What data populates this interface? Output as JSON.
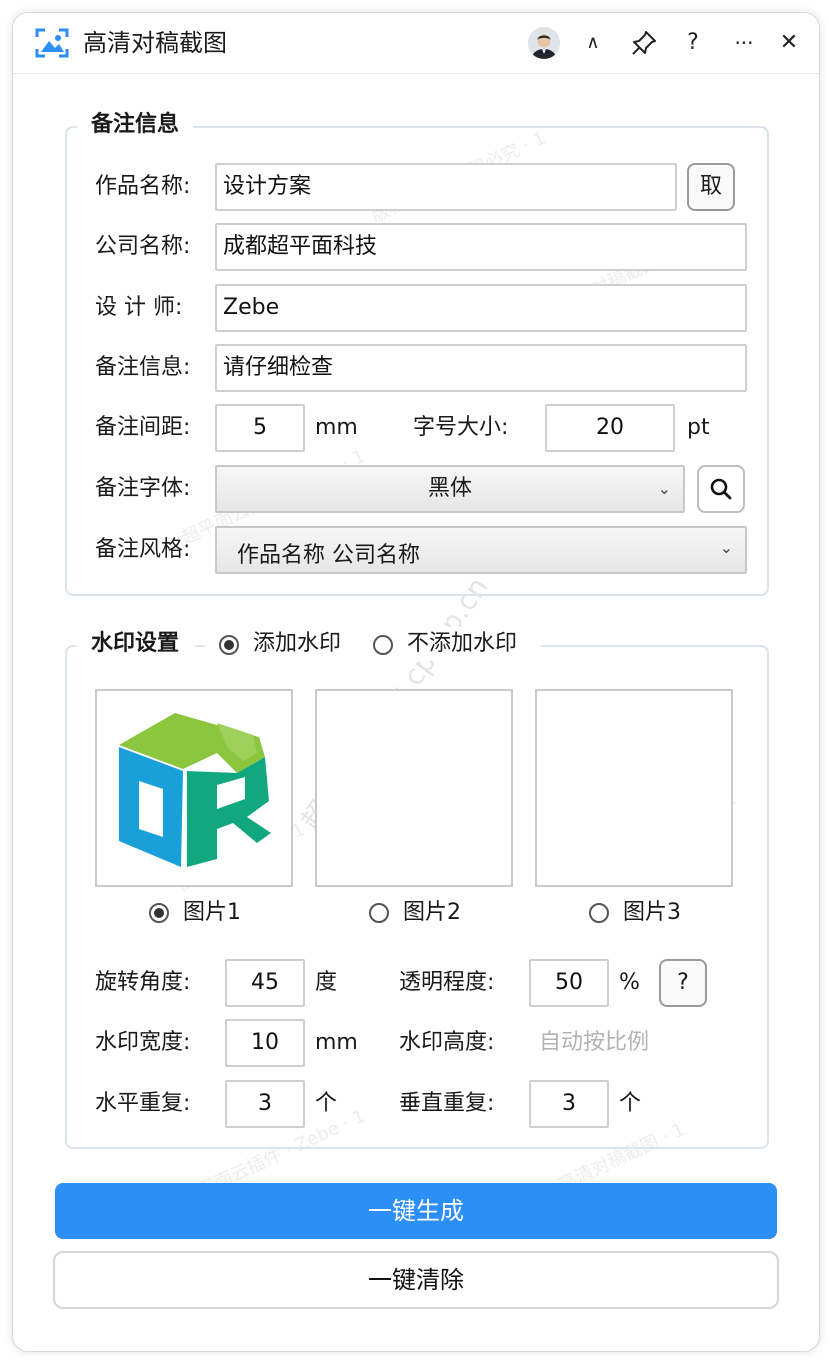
{
  "window": {
    "title": "高清对稿截图",
    "controls": {
      "collapse": "∧",
      "pin": "pin-icon",
      "help": "?",
      "more": "···",
      "close": "✕"
    }
  },
  "notes": {
    "legend": "备注信息",
    "work_name": {
      "label": "作品名称:",
      "value": "设计方案",
      "pick_button": "取"
    },
    "company": {
      "label": "公司名称:",
      "value": "成都超平面科技"
    },
    "designer": {
      "label": "设 计 师:",
      "value": "Zebe"
    },
    "remark": {
      "label": "备注信息:",
      "value": "请仔细检查"
    },
    "spacing": {
      "label": "备注间距:",
      "value": "5",
      "unit": "mm"
    },
    "font_size": {
      "label": "字号大小:",
      "value": "20",
      "unit": "pt"
    },
    "font": {
      "label": "备注字体:",
      "value": "黑体"
    },
    "style": {
      "label": "备注风格:",
      "value": "作品名称 公司名称"
    }
  },
  "watermark": {
    "legend": "水印设置",
    "add_option": "添加水印",
    "no_option": "不添加水印",
    "selected_mode": "添加水印",
    "images": [
      {
        "label": "图片1",
        "selected": true,
        "logo_text": "DR"
      },
      {
        "label": "图片2",
        "selected": false
      },
      {
        "label": "图片3",
        "selected": false
      }
    ],
    "rotation": {
      "label": "旋转角度:",
      "value": "45",
      "unit": "度"
    },
    "opacity": {
      "label": "透明程度:",
      "value": "50",
      "unit": "%",
      "help": "?"
    },
    "width": {
      "label": "水印宽度:",
      "value": "10",
      "unit": "mm"
    },
    "height": {
      "label": "水印高度:",
      "value": "自动按比例"
    },
    "h_repeat": {
      "label": "水平重复:",
      "value": "3",
      "unit": "个"
    },
    "v_repeat": {
      "label": "垂直重复:",
      "value": "3",
      "unit": "个"
    }
  },
  "actions": {
    "generate": "一键生成",
    "clear": "一键清除"
  },
  "overlay_watermark": {
    "big": "超平面云插件 cpxcp.cn",
    "small": [
      "版权所有 · 仿冒必究 · 1",
      "超平面云插件 · Zebe · 1",
      "高清对稿截图 · 1"
    ]
  },
  "colors": {
    "accent": "#2b8ff7",
    "logo_green": "#8cc63f",
    "logo_blue": "#1aa0d8",
    "logo_teal": "#11a87f"
  }
}
